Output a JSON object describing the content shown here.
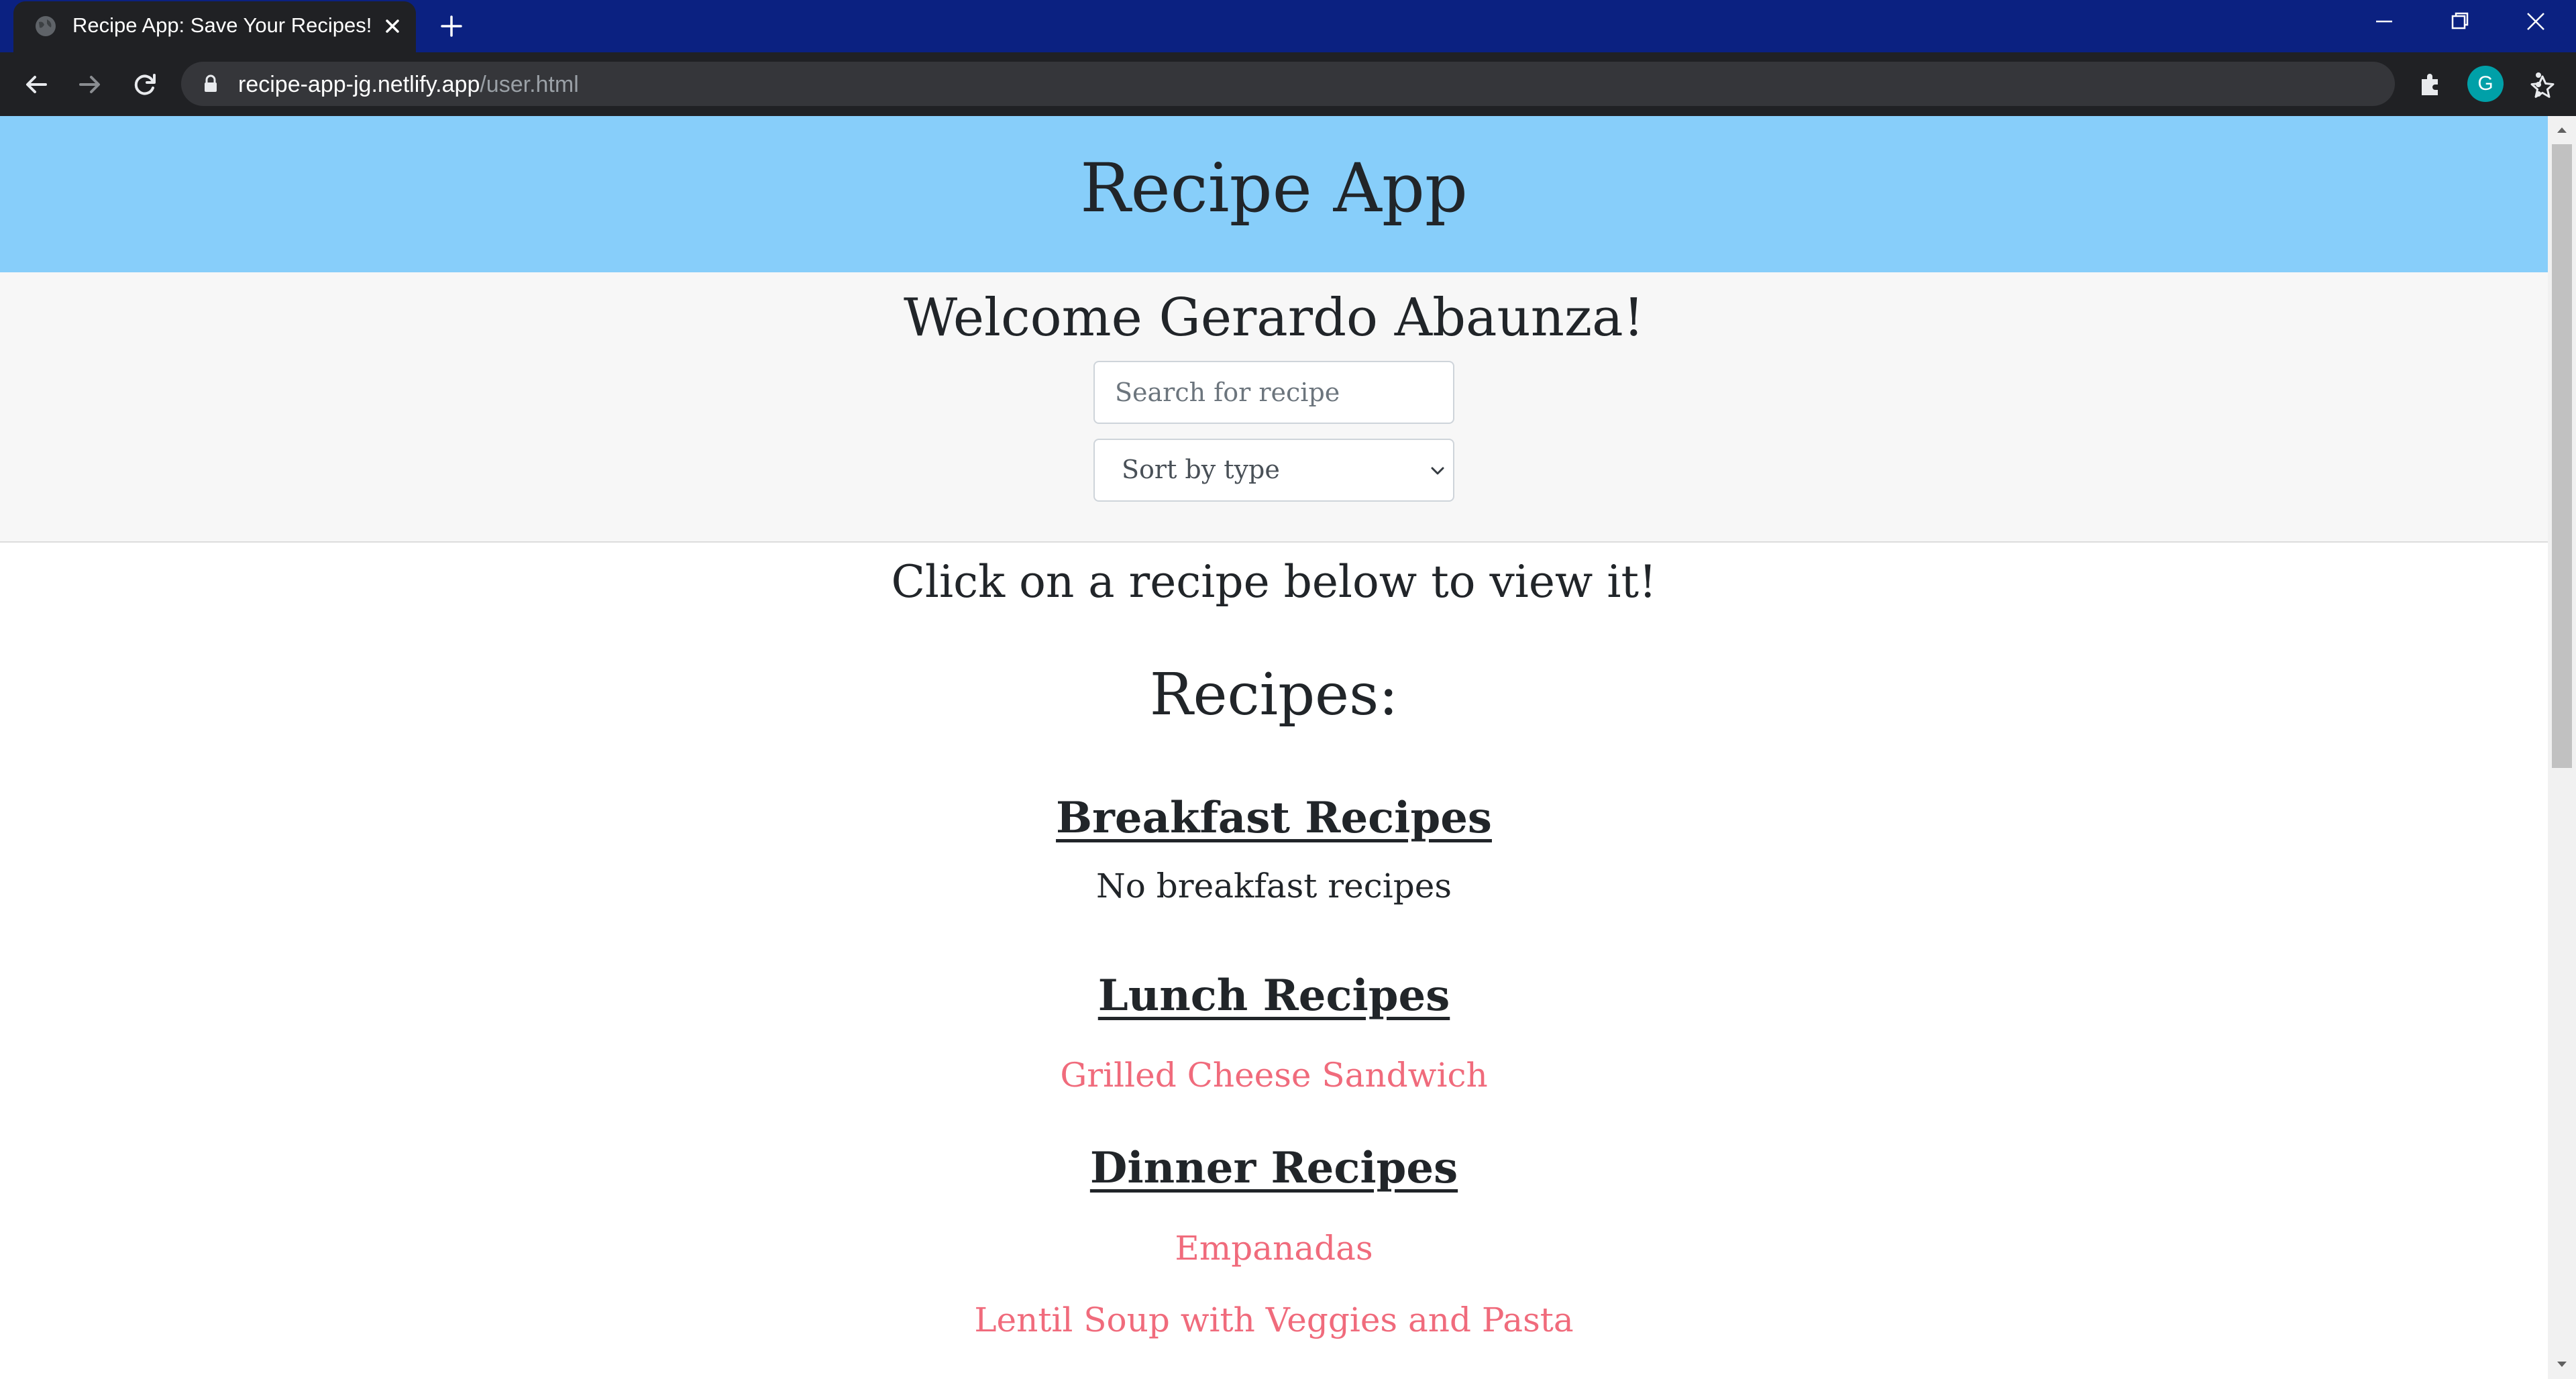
{
  "browser": {
    "tab_title": "Recipe App: Save Your Recipes!",
    "url_host": "recipe-app-jg.netlify.app",
    "url_path": "/user.html",
    "profile_initial": "G",
    "colors": {
      "tabstrip": "#0b2181",
      "toolbar": "#202124",
      "profile": "#00a0a8"
    }
  },
  "page": {
    "header": {
      "title": "Recipe App",
      "background": "#87cefa"
    },
    "user_panel": {
      "welcome": "Welcome Gerardo Abaunza!",
      "search_placeholder": "Search for recipe",
      "sort_selected": "Sort by type"
    },
    "instruction": "Click on a recipe below to view it!",
    "recipes_heading": "Recipes:",
    "categories": {
      "breakfast": {
        "title": "Breakfast Recipes",
        "empty_text": "No breakfast recipes"
      },
      "lunch": {
        "title": "Lunch Recipes",
        "items": [
          "Grilled Cheese Sandwich"
        ]
      },
      "dinner": {
        "title": "Dinner Recipes",
        "items": [
          "Empanadas",
          "Lentil Soup with Veggies and Pasta"
        ]
      }
    },
    "link_color": "#f06b7c"
  }
}
